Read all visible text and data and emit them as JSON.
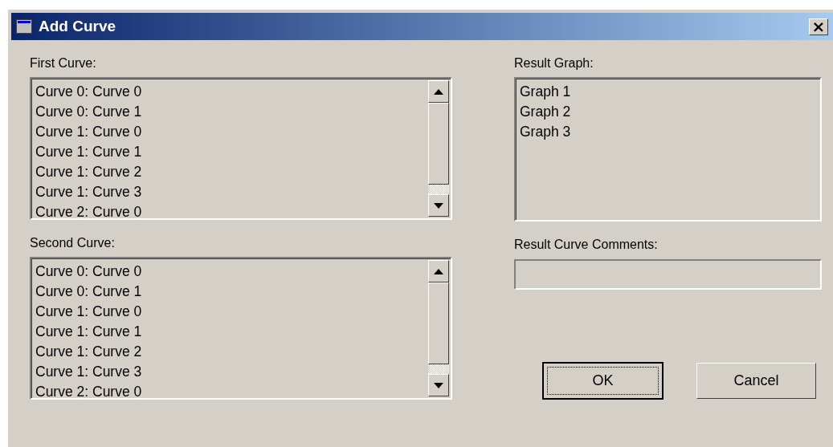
{
  "window": {
    "title": "Add Curve",
    "close": "×"
  },
  "first_curve": {
    "label": "First Curve:",
    "items": [
      "Curve 0: Curve 0",
      "Curve 0: Curve 1",
      "Curve 1: Curve 0",
      "Curve 1: Curve 1",
      "Curve 1: Curve 2",
      "Curve 1: Curve 3",
      "Curve 2: Curve 0"
    ]
  },
  "second_curve": {
    "label": "Second Curve:",
    "items": [
      "Curve 0: Curve 0",
      "Curve 0: Curve 1",
      "Curve 1: Curve 0",
      "Curve 1: Curve 1",
      "Curve 1: Curve 2",
      "Curve 1: Curve 3",
      "Curve 2: Curve 0"
    ]
  },
  "result_graph": {
    "label": "Result Graph:",
    "items": [
      "Graph 1",
      "Graph 2",
      "Graph 3"
    ]
  },
  "result_curve_comments": {
    "label": "Result Curve Comments:"
  },
  "buttons": [
    {
      "label": "OK",
      "default": true
    },
    {
      "label": "Cancel",
      "default": false
    }
  ]
}
